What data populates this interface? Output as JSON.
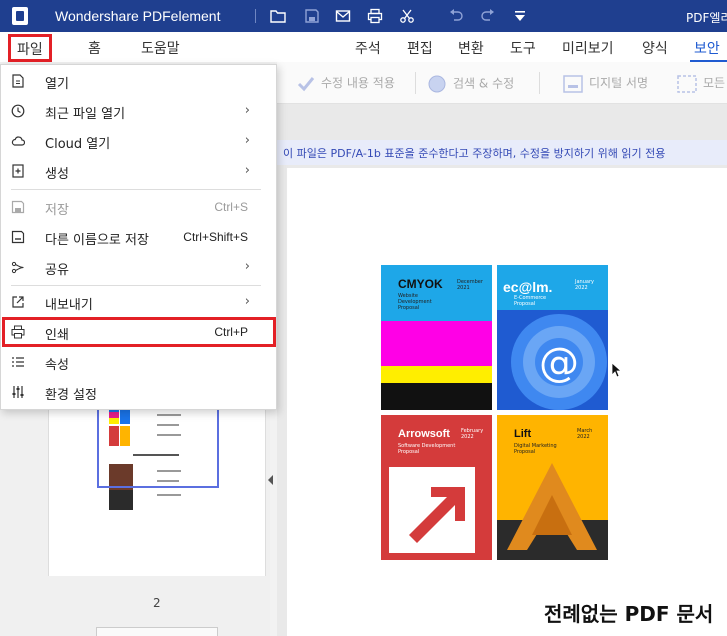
{
  "app": {
    "title": "Wondershare PDFelement",
    "document_title": "PDF엘리"
  },
  "menubar": {
    "file": "파일",
    "home": "홈",
    "help": "도움말",
    "tabs": [
      "주석",
      "편집",
      "변환",
      "도구",
      "미리보기",
      "양식",
      "보안"
    ]
  },
  "toolbar": {
    "apply": "수정 내용 적용",
    "search": "검색 & 수정",
    "digital_sign": "디지털 서명",
    "more": "모든"
  },
  "notice": "이 파일은 PDF/A-1b 표준을 준수한다고 주장하며, 수정을 방지하기 위해 읽기 전용",
  "file_menu": {
    "open": "열기",
    "recent": "최근 파일 열기",
    "cloud": "Cloud 열기",
    "create": "생성",
    "save": "저장",
    "save_shortcut": "Ctrl+S",
    "save_as": "다른 이름으로 저장",
    "save_as_shortcut": "Ctrl+Shift+S",
    "share": "공유",
    "export": "내보내기",
    "print": "인쇄",
    "print_shortcut": "Ctrl+P",
    "properties": "속성",
    "preferences": "환경 설정",
    "arrow": "›"
  },
  "thumbnail": {
    "page_number": "2"
  },
  "page": {
    "tiles": {
      "cmyok": {
        "title": "CMYOK",
        "sub": "Website Development Proposal",
        "tag": "December 2021"
      },
      "ecom": {
        "title": "ec@lm.",
        "sub": "E-Commerce Proposal",
        "tag": "January 2022"
      },
      "arrow": {
        "title": "Arrowsoft",
        "sub": "Software Development Proposal",
        "tag": "February 2022"
      },
      "lift": {
        "title": "Lift",
        "sub": "Digital Marketing Proposal",
        "tag": "March 2022"
      }
    },
    "heading": "전례없는 PDF 문서"
  },
  "colors": {
    "title_bar": "#1f3f8f",
    "accent": "#1f5bd1",
    "highlight": "#e32026"
  }
}
